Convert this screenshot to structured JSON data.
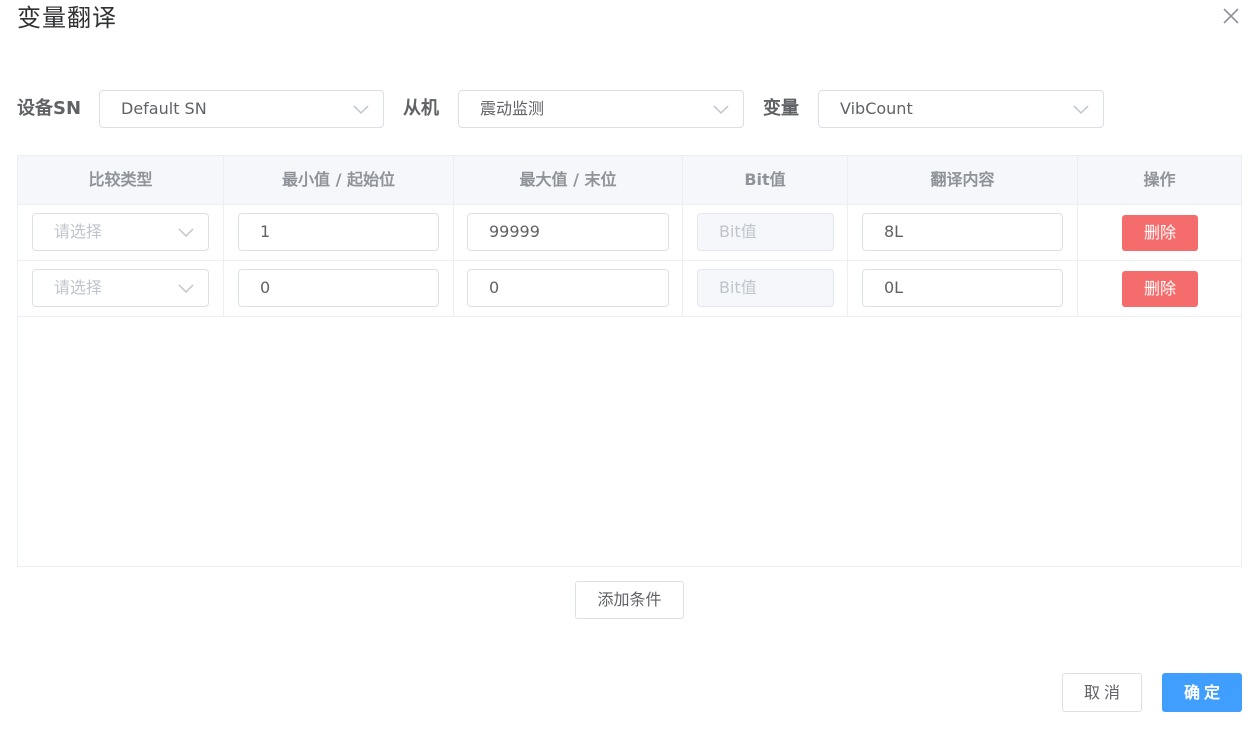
{
  "dialog": {
    "title": "变量翻译"
  },
  "filters": {
    "device_sn": {
      "label": "设备SN",
      "value": "Default SN"
    },
    "slave": {
      "label": "从机",
      "value": "震动监测"
    },
    "variable": {
      "label": "变量",
      "value": "VibCount"
    }
  },
  "table": {
    "headers": [
      "比较类型",
      "最小值 / 起始位",
      "最大值 / 末位",
      "Bit值",
      "翻译内容",
      "操作"
    ],
    "rows": [
      {
        "compare_type_placeholder": "请选择",
        "min": "1",
        "max": "99999",
        "bit_placeholder": "Bit值",
        "translation": "8L",
        "action": "删除"
      },
      {
        "compare_type_placeholder": "请选择",
        "min": "0",
        "max": "0",
        "bit_placeholder": "Bit值",
        "translation": "0L",
        "action": "删除"
      }
    ]
  },
  "buttons": {
    "add_condition": "添加条件",
    "cancel": "取消",
    "confirm": "确定"
  },
  "icons": {
    "close": "close-icon",
    "dropdown": "chevron-down-icon"
  },
  "colors": {
    "primary": "#409eff",
    "danger": "#f56c6c",
    "border": "#dcdfe6"
  }
}
